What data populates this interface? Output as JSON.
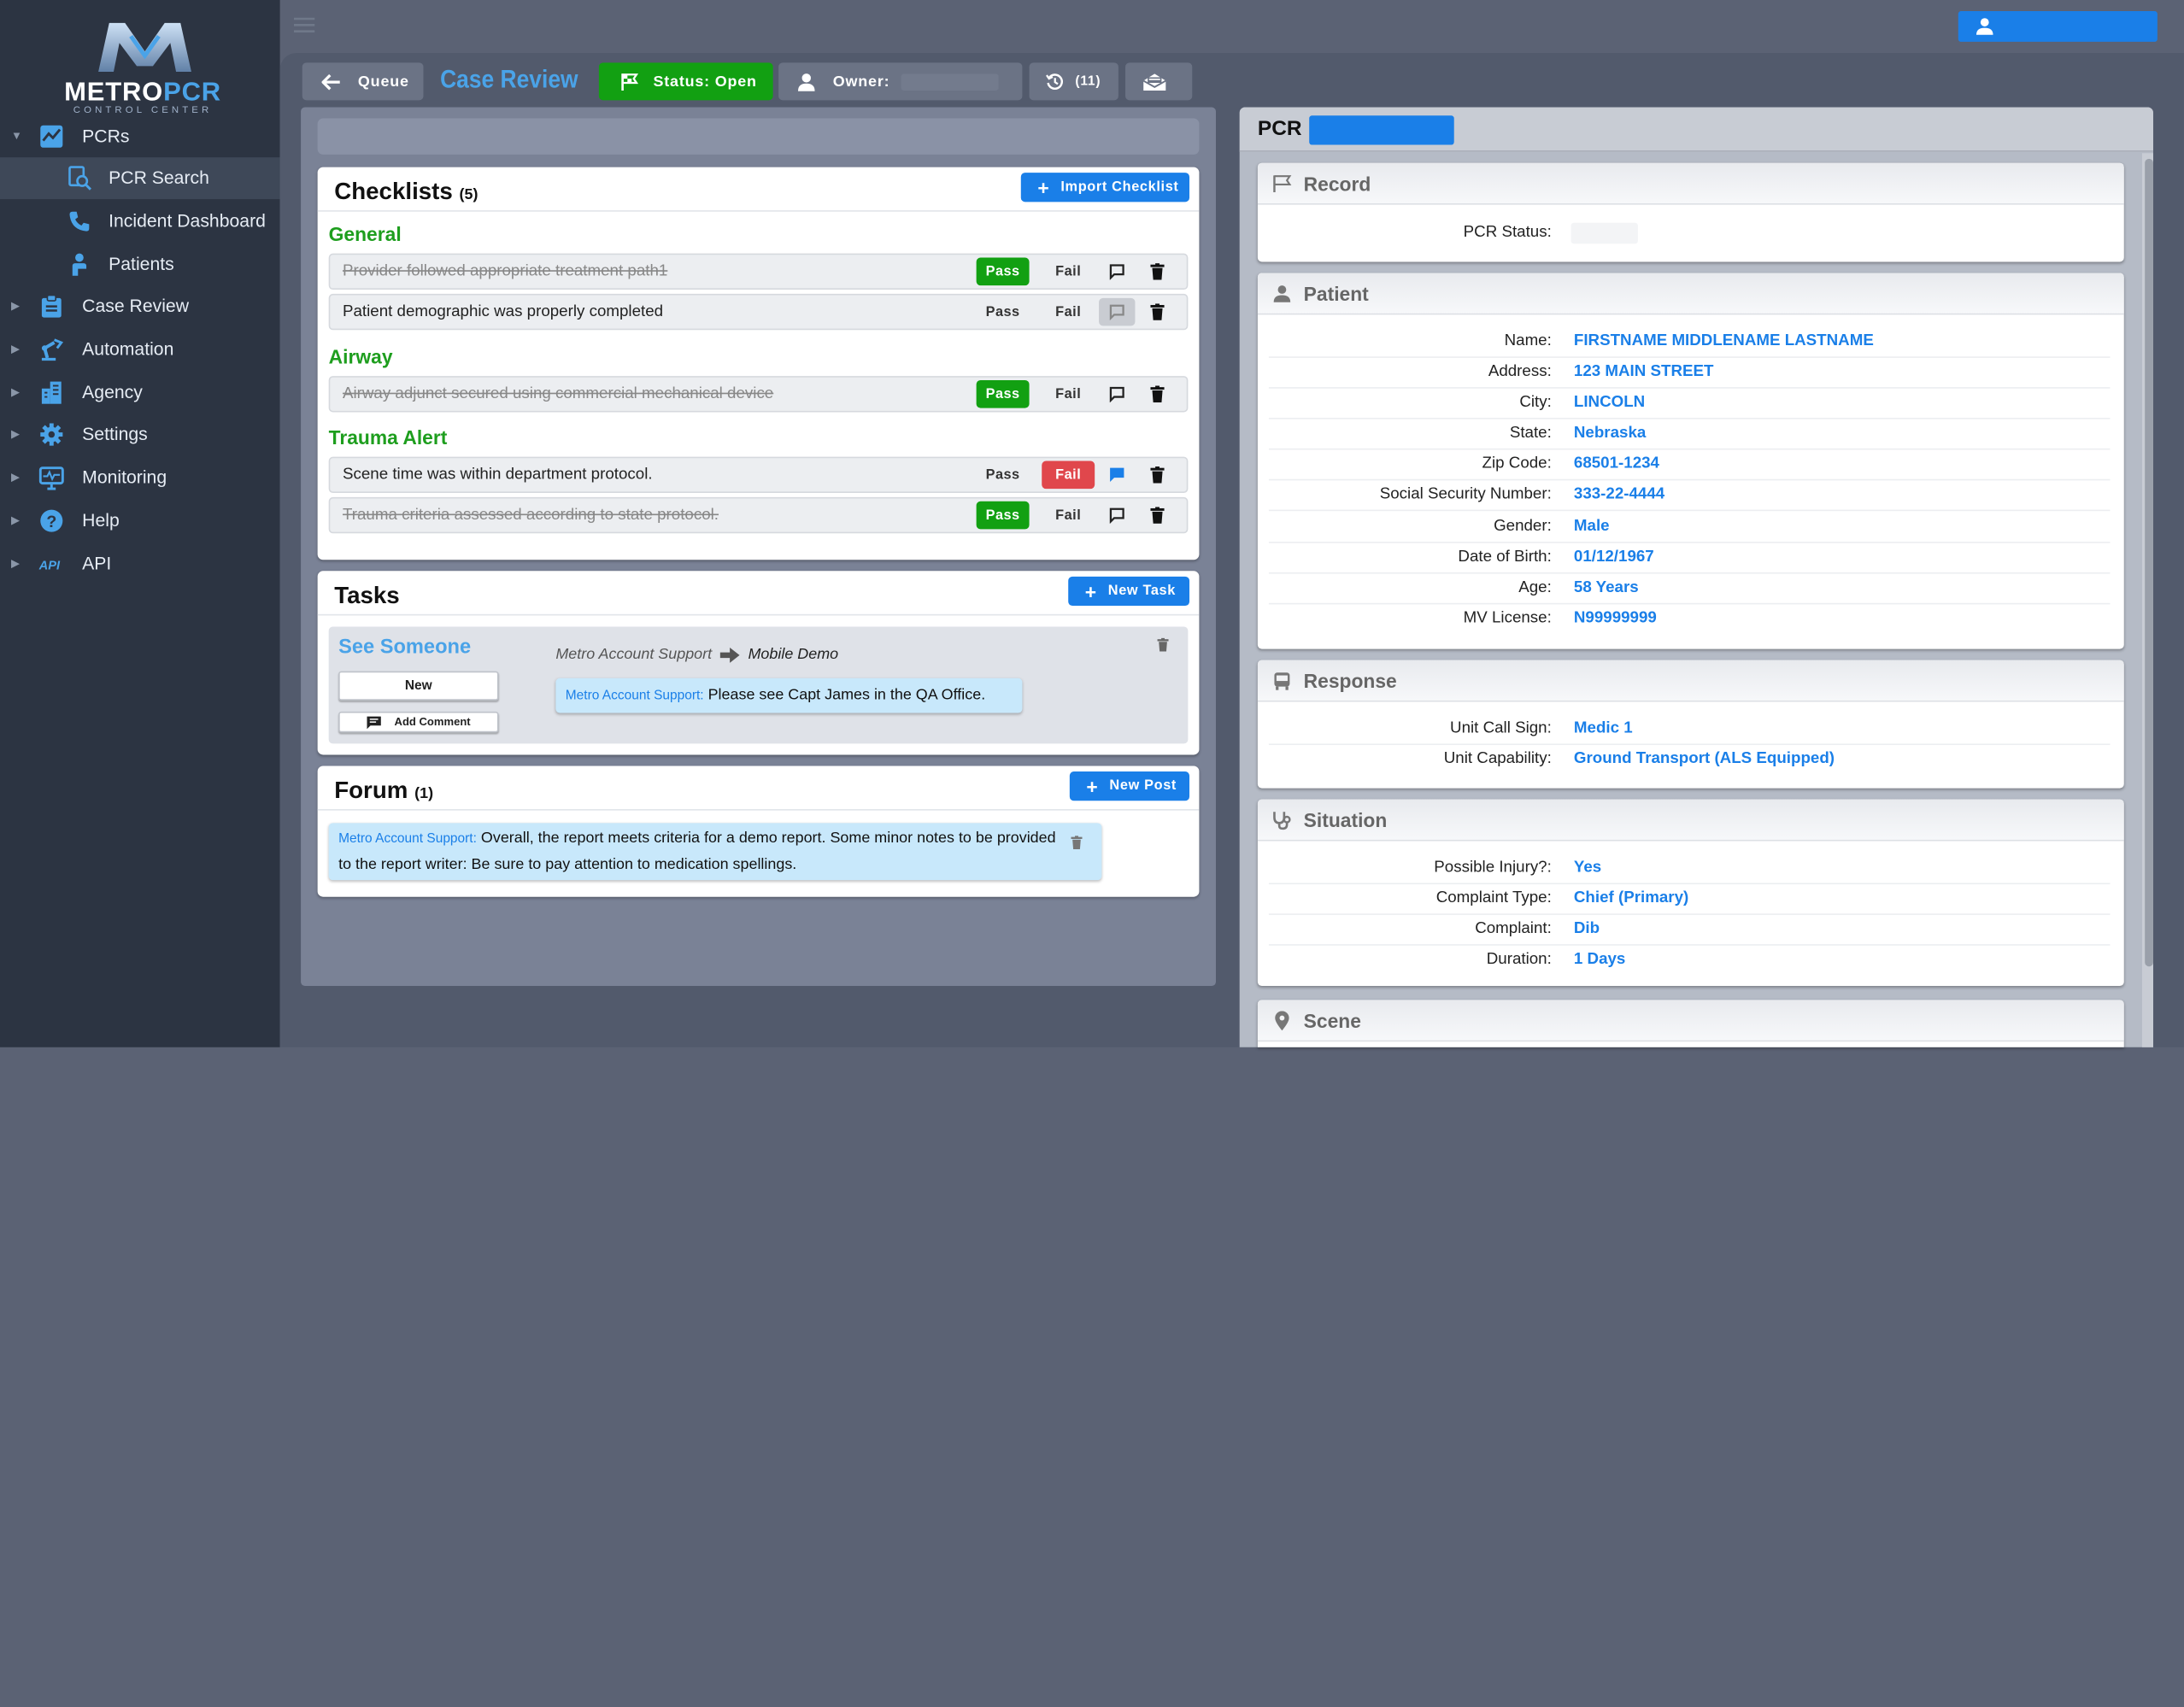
{
  "brand": {
    "name_main": "METRO",
    "name_accent": "PCR",
    "subtitle": "CONTROL CENTER"
  },
  "sidebar": {
    "items": [
      {
        "label": "PCRs",
        "icon": "chart-icon",
        "expanded": true
      },
      {
        "label": "PCR Search",
        "icon": "search-doc-icon",
        "active": true
      },
      {
        "label": "Incident Dashboard",
        "icon": "phone-icon"
      },
      {
        "label": "Patients",
        "icon": "patient-icon"
      },
      {
        "label": "Case Review",
        "icon": "clipboard-icon"
      },
      {
        "label": "Automation",
        "icon": "robot-arm-icon"
      },
      {
        "label": "Agency",
        "icon": "building-icon"
      },
      {
        "label": "Settings",
        "icon": "gear-icon"
      },
      {
        "label": "Monitoring",
        "icon": "monitor-icon"
      },
      {
        "label": "Help",
        "icon": "help-icon"
      },
      {
        "label": "API",
        "icon": "api-icon"
      }
    ]
  },
  "toolbar": {
    "queue_label": "Queue",
    "title": "Case Review",
    "status_label": "Status: Open",
    "owner_label": "Owner:",
    "history_label": "(11)"
  },
  "colors": {
    "accent": "#1a7fe8",
    "pass": "#12a012",
    "fail": "#e0474c",
    "section": "#1e9e1e"
  },
  "checklists": {
    "title": "Checklists",
    "count": "(5)",
    "import_label": "Import Checklist",
    "pass_label": "Pass",
    "fail_label": "Fail",
    "sections": [
      {
        "name": "General",
        "items": [
          {
            "text": "Provider followed appropriate treatment path1",
            "result": "pass",
            "struck": true
          },
          {
            "text": "Patient demographic was properly completed",
            "result": "none",
            "struck": false
          }
        ]
      },
      {
        "name": "Airway",
        "items": [
          {
            "text": "Airway adjunct secured using commercial mechanical device",
            "result": "pass",
            "struck": true
          }
        ]
      },
      {
        "name": "Trauma Alert",
        "items": [
          {
            "text": "Scene time was within department protocol.",
            "result": "fail",
            "struck": false
          },
          {
            "text": "Trauma criteria assessed according to state protocol.",
            "result": "pass",
            "struck": true
          }
        ]
      }
    ]
  },
  "tasks": {
    "title": "Tasks",
    "new_label": "New Task",
    "task_title": "See Someone",
    "from": "Metro Account Support",
    "to": "Mobile Demo",
    "status": "New",
    "add_comment_label": "Add Comment",
    "message_author": "Metro Account Support:",
    "message_text": "Please see Capt James in the QA Office."
  },
  "forum": {
    "title": "Forum",
    "count": "(1)",
    "new_label": "New Post",
    "post_author": "Metro Account Support:",
    "post_text": "Overall, the report meets criteria for a demo report. Some minor notes to be provided to the report writer: Be sure to pay attention to medication spellings."
  },
  "pcr": {
    "title": "PCR",
    "record": {
      "heading": "Record",
      "fields": [
        {
          "k": "PCR Status:",
          "v": ""
        }
      ]
    },
    "patient": {
      "heading": "Patient",
      "fields": [
        {
          "k": "Name:",
          "v": "FIRSTNAME MIDDLENAME LASTNAME"
        },
        {
          "k": "Address:",
          "v": "123 MAIN STREET"
        },
        {
          "k": "City:",
          "v": "LINCOLN"
        },
        {
          "k": "State:",
          "v": "Nebraska"
        },
        {
          "k": "Zip Code:",
          "v": "68501-1234"
        },
        {
          "k": "Social Security Number:",
          "v": "333-22-4444"
        },
        {
          "k": "Gender:",
          "v": "Male"
        },
        {
          "k": "Date of Birth:",
          "v": "01/12/1967"
        },
        {
          "k": "Age:",
          "v": "58 Years"
        },
        {
          "k": "MV License:",
          "v": "N99999999"
        }
      ]
    },
    "response": {
      "heading": "Response",
      "fields": [
        {
          "k": "Unit Call Sign:",
          "v": "Medic 1"
        },
        {
          "k": "Unit Capability:",
          "v": "Ground Transport (ALS Equipped)"
        }
      ]
    },
    "situation": {
      "heading": "Situation",
      "fields": [
        {
          "k": "Possible Injury?:",
          "v": "Yes"
        },
        {
          "k": "Complaint Type:",
          "v": "Chief (Primary)"
        },
        {
          "k": "Complaint:",
          "v": "Dib"
        },
        {
          "k": "Duration:",
          "v": "1 Days"
        }
      ]
    },
    "scene": {
      "heading": "Scene"
    }
  }
}
